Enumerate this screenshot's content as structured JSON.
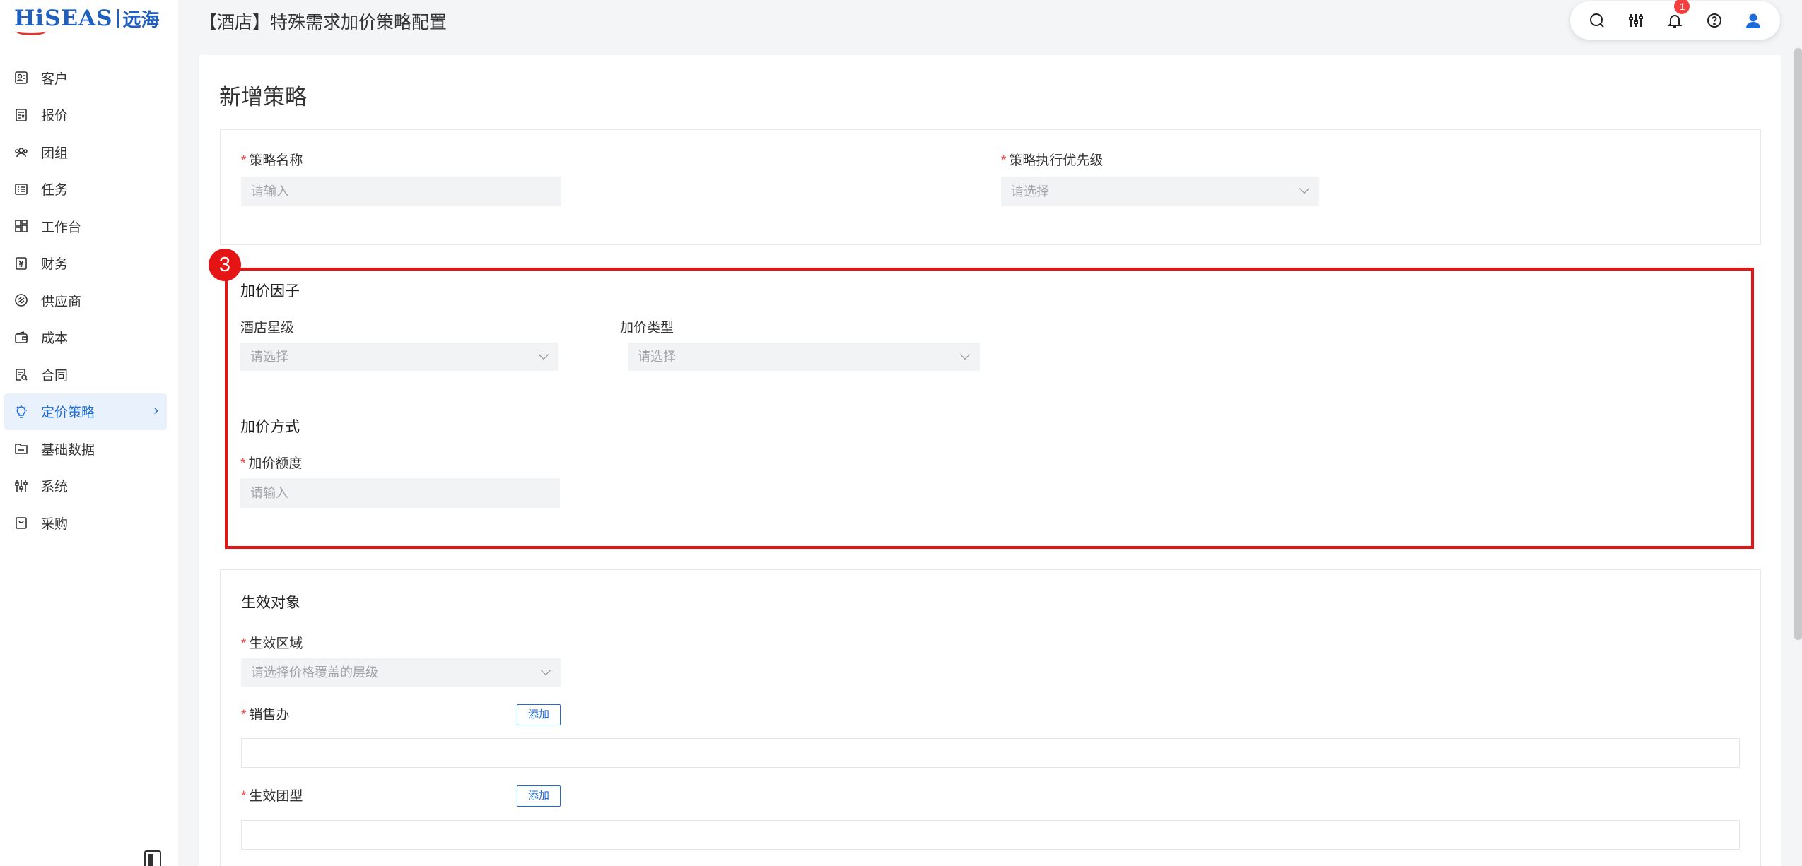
{
  "logo": {
    "text": "HiSEAS",
    "cn": "远海"
  },
  "sidebar": {
    "items": [
      {
        "label": "客户",
        "icon": "customer-icon"
      },
      {
        "label": "报价",
        "icon": "quote-icon"
      },
      {
        "label": "团组",
        "icon": "group-icon"
      },
      {
        "label": "任务",
        "icon": "task-icon"
      },
      {
        "label": "工作台",
        "icon": "workbench-icon"
      },
      {
        "label": "财务",
        "icon": "finance-icon"
      },
      {
        "label": "供应商",
        "icon": "supplier-icon"
      },
      {
        "label": "成本",
        "icon": "wallet-icon"
      },
      {
        "label": "合同",
        "icon": "contract-icon"
      },
      {
        "label": "定价策略",
        "icon": "bulb-icon",
        "active": true
      },
      {
        "label": "基础数据",
        "icon": "folder-icon"
      },
      {
        "label": "系统",
        "icon": "settings-sliders-icon"
      },
      {
        "label": "采购",
        "icon": "bag-icon"
      }
    ]
  },
  "header": {
    "title": "【酒店】特殊需求加价策略配置",
    "notification_count": "1"
  },
  "form": {
    "title": "新增策略",
    "basic": {
      "name_label": "策略名称",
      "name_placeholder": "请输入",
      "priority_label": "策略执行优先级",
      "priority_placeholder": "请选择"
    },
    "factor": {
      "title": "加价因子",
      "star_label": "酒店星级",
      "star_placeholder": "请选择",
      "type_label": "加价类型",
      "type_placeholder": "请选择"
    },
    "method": {
      "title": "加价方式",
      "amount_label": "加价额度",
      "amount_placeholder": "请输入"
    },
    "target": {
      "title": "生效对象",
      "region_label": "生效区域",
      "region_placeholder": "请选择价格覆盖的层级",
      "office_label": "销售办",
      "office_add": "添加",
      "group_label": "生效团型",
      "group_add": "添加"
    }
  },
  "highlight": {
    "number": "3"
  },
  "colors": {
    "accent": "#1e6ad9",
    "highlight": "#e61515",
    "required": "#f53f3f"
  }
}
